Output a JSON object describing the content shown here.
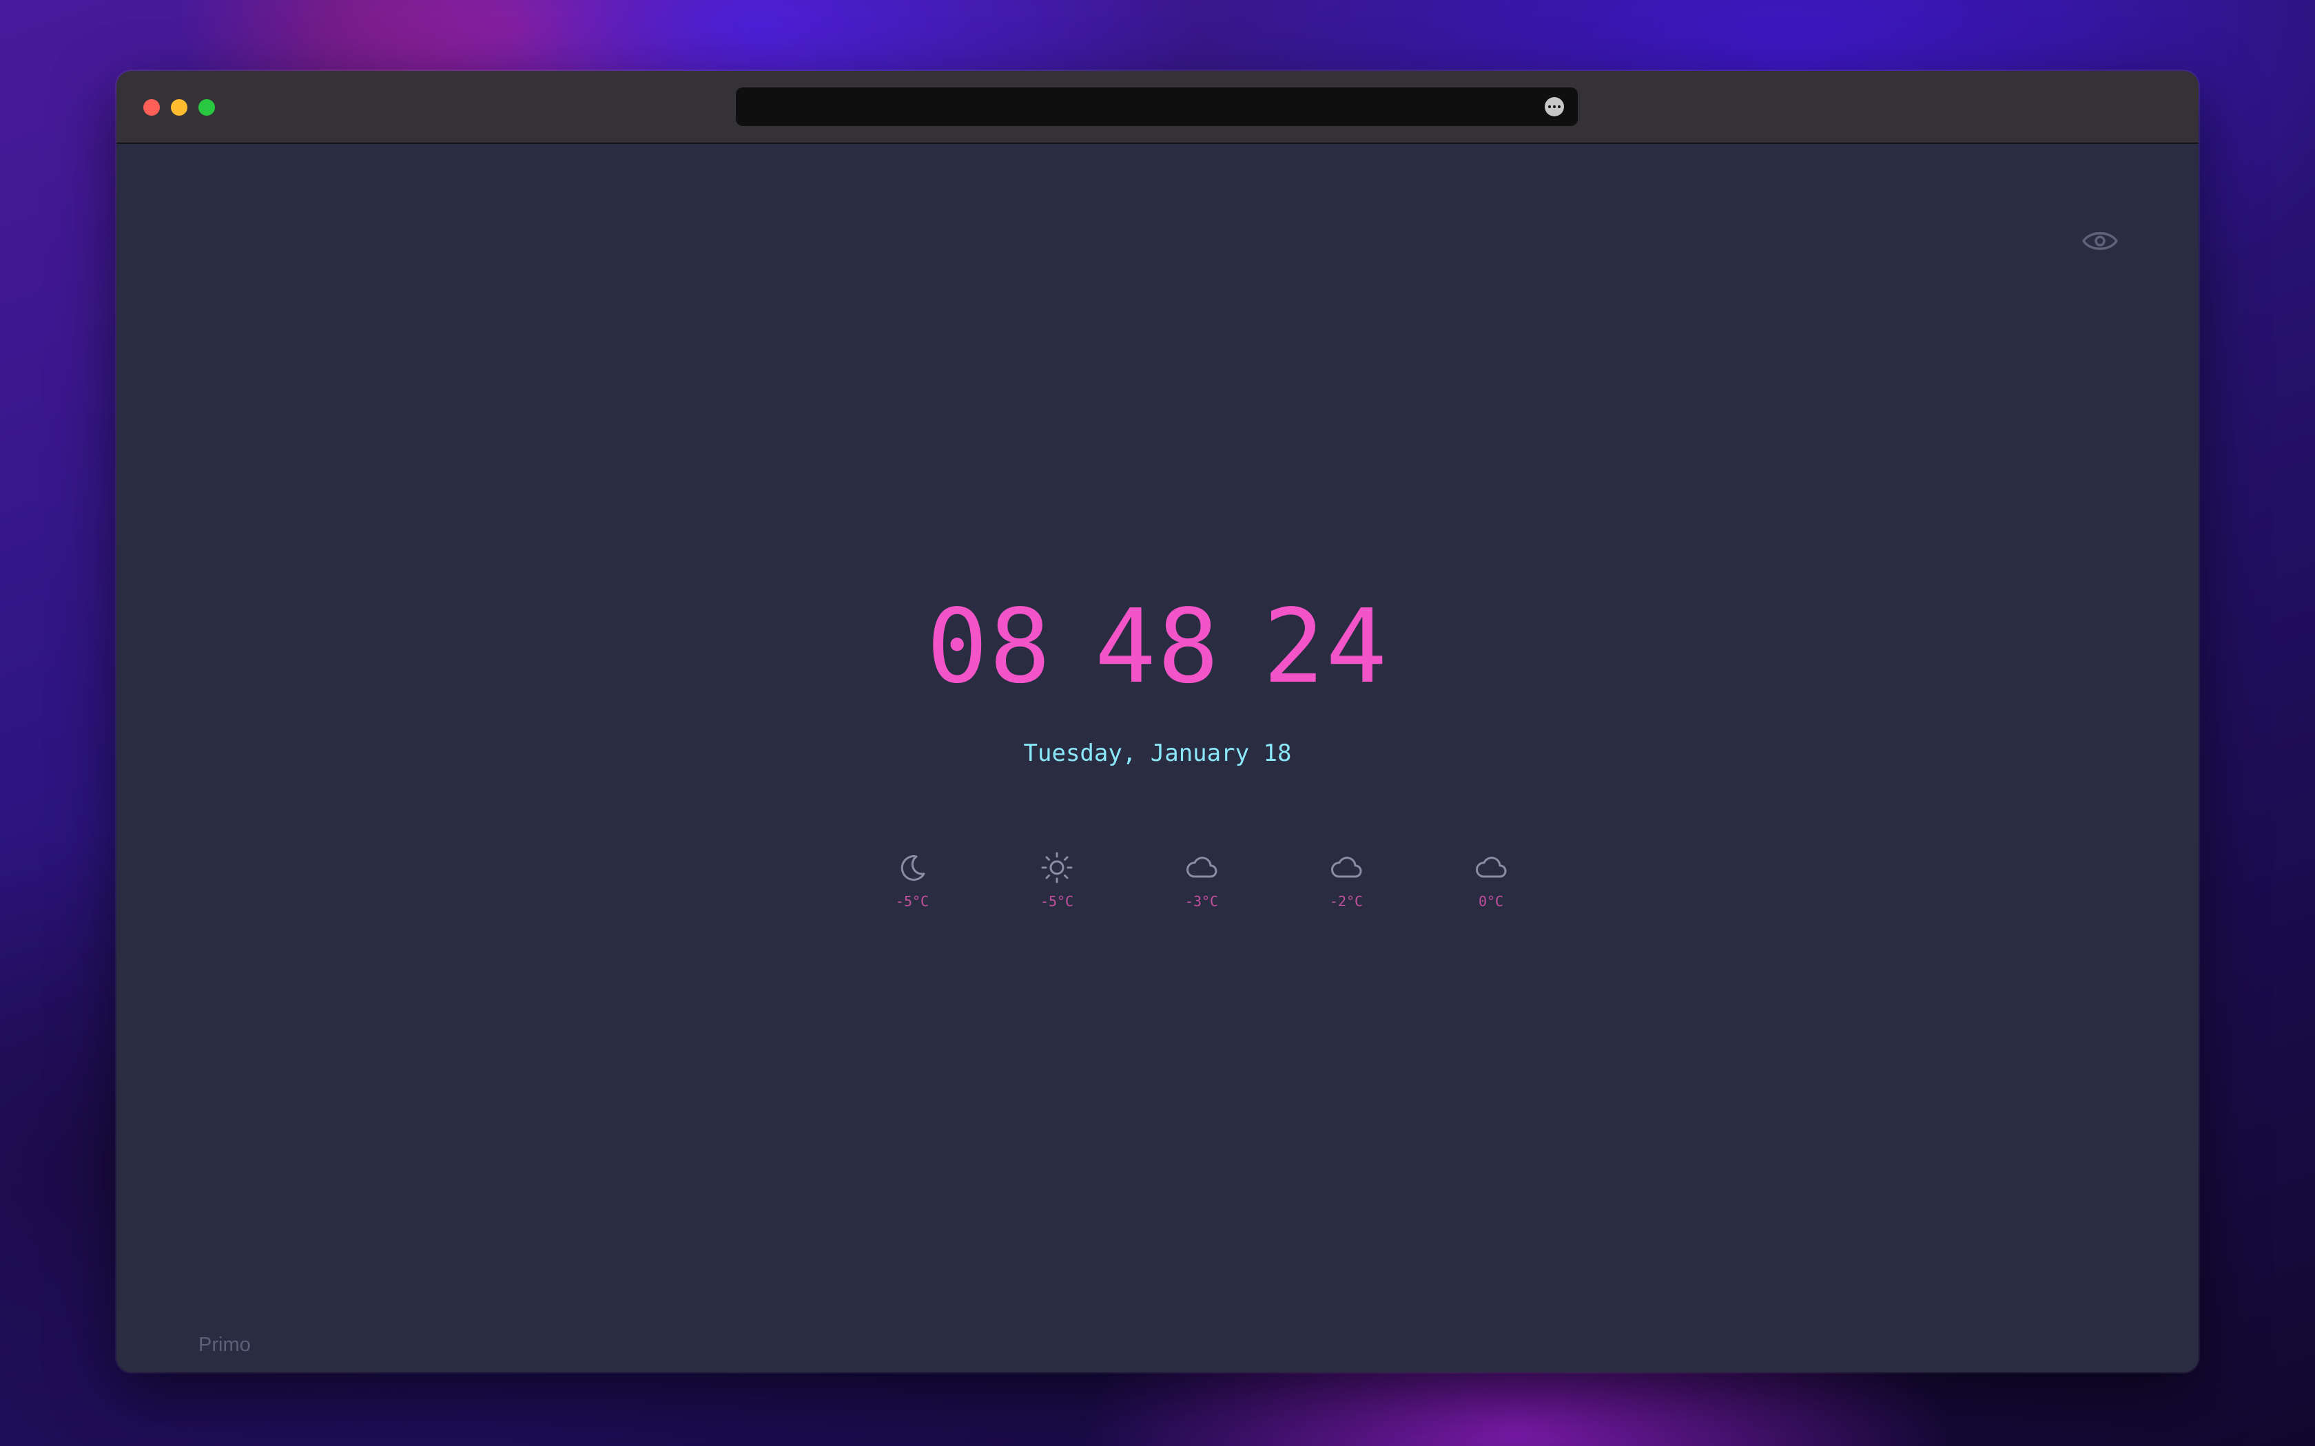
{
  "window": {
    "traffic_lights": [
      "close",
      "minimize",
      "zoom"
    ],
    "address_bar": {
      "value": "",
      "placeholder": ""
    }
  },
  "toolbar": {
    "more_icon": "ellipsis-circle-icon",
    "visibility_icon": "eye-icon"
  },
  "clock": {
    "hours": "08",
    "minutes": "48",
    "seconds": "24"
  },
  "date": "Tuesday, January 18",
  "forecast": [
    {
      "icon": "moon-icon",
      "temp": "-5°C"
    },
    {
      "icon": "sun-icon",
      "temp": "-5°C"
    },
    {
      "icon": "cloud-icon",
      "temp": "-3°C"
    },
    {
      "icon": "cloud-icon",
      "temp": "-2°C"
    },
    {
      "icon": "cloud-icon",
      "temp": "0°C"
    }
  ],
  "footer": {
    "brand": "Primo"
  },
  "colors": {
    "clock": "#f355c8",
    "date": "#8be8fb",
    "temperature": "#c2509c",
    "icon": "#8a8da3",
    "background": "#2a2d42",
    "titlebar": "#353237"
  }
}
